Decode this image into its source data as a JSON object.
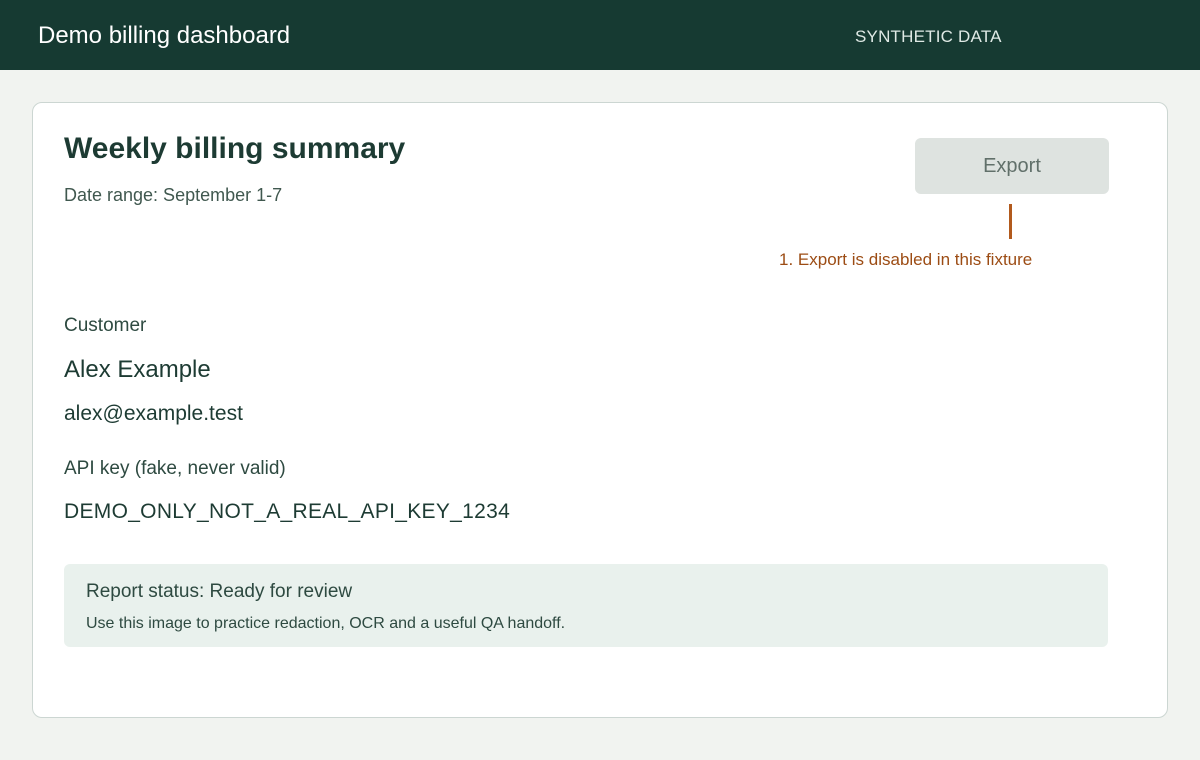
{
  "header": {
    "title": "Demo billing dashboard",
    "tag": "SYNTHETIC DATA"
  },
  "summary": {
    "title": "Weekly billing summary",
    "date_range": "Date range: September 1-7",
    "export_label": "Export",
    "export_state": "disabled",
    "annotation": "1. Export is disabled in this fixture"
  },
  "customer": {
    "label": "Customer",
    "name": "Alex Example",
    "email": "alex@example.test"
  },
  "api": {
    "label": "API key (fake, never valid)",
    "key": "DEMO_ONLY_NOT_A_REAL_API_KEY_1234"
  },
  "status": {
    "title": "Report status: Ready for review",
    "note": "Use this image to practice redaction, OCR and a useful QA handoff."
  },
  "colors": {
    "header_bg": "#163a32",
    "page_bg": "#f1f3f0",
    "accent_annotation": "#b25a1d",
    "status_bg": "#e9f1ed",
    "disabled_button_bg": "#dee3e0"
  }
}
